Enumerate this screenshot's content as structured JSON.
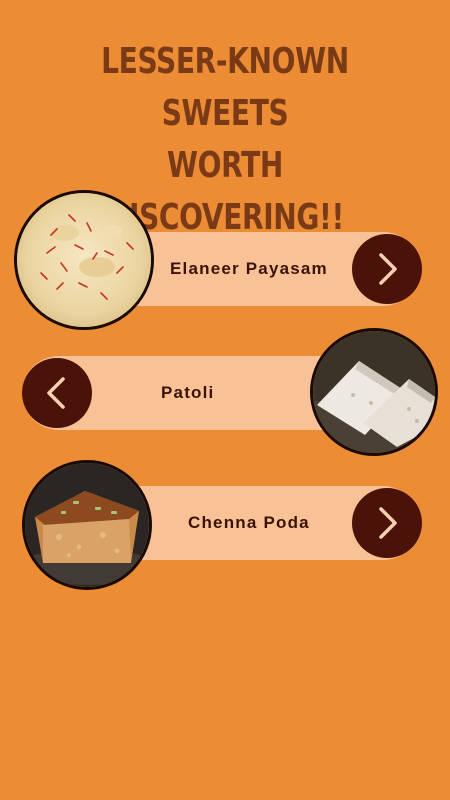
{
  "title": {
    "line1": "LESSER-KNOWN SWEETS",
    "line2": "WORTH DISCOVERING!!"
  },
  "colors": {
    "background": "#EC8C35",
    "title": "#7A3A16",
    "card": "#F8C296",
    "button": "#4A1208",
    "arrow": "#F6D2B2"
  },
  "sweets": [
    {
      "label": "Elaneer Payasam",
      "arrow_icon": "chevron-right-icon",
      "photo": "kheer-with-saffron"
    },
    {
      "label": "Patoli",
      "arrow_icon": "chevron-left-icon",
      "photo": "steamed-leaf-rolls"
    },
    {
      "label": "Chenna Poda",
      "arrow_icon": "chevron-right-icon",
      "photo": "baked-cheese-cake-slice"
    }
  ]
}
